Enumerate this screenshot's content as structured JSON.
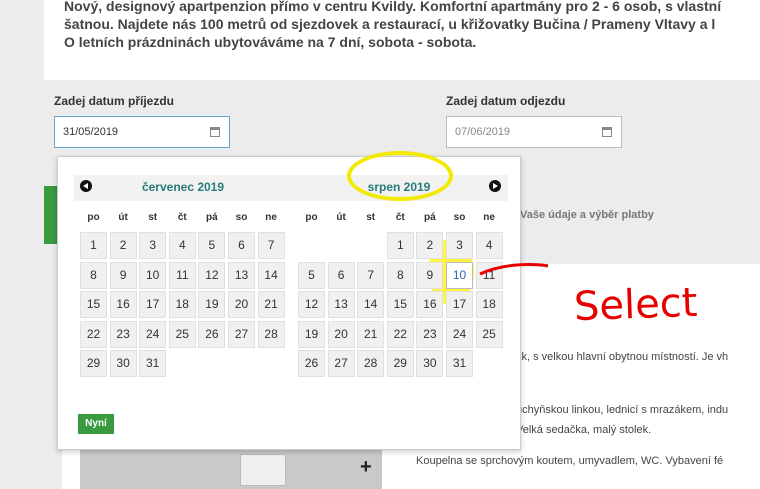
{
  "intro": {
    "line1": "Nový, designový apartpenzion přímo v centru Kvildy. Komfortní apartmány pro 2 - 6 osob, s vlastní",
    "line2": "šatnou. Najdete nás 100 metrů od sjezdovek a restaurací, u křižovatky Bučina / Prameny Vltavy a l",
    "line3": "O letních prázdninách ubytováváme na 7 dní, sobota - sobota."
  },
  "arrival": {
    "label": "Zadej datum příjezdu",
    "value": "31/05/2019"
  },
  "departure": {
    "label": "Zadej datum odjezdu",
    "value": "07/06/2019"
  },
  "datepicker": {
    "left_month": "červenec 2019",
    "right_month": "srpen 2019",
    "weekdays": [
      "po",
      "út",
      "st",
      "čt",
      "pá",
      "so",
      "ne"
    ],
    "left_start_col": 0,
    "left_days": 31,
    "right_start_col": 3,
    "right_days": 31,
    "selected_right_day": 10,
    "now_label": "Nyní"
  },
  "payment_step": "Vaše údaje a výběr platby",
  "content": {
    "line1": "kk, s velkou hlavní obytnou místností. Je vh",
    "line2": "uchyňskou linkou, lednicí s mrazákem, indu",
    "line3": "Velká sedačka, malý stolek.",
    "line4": "Koupelna se sprchovým koutem, umyvadlem, WC. Vybavení fé"
  },
  "annotation": {
    "word": "Select"
  },
  "colors": {
    "green": "#3a9a40",
    "teal": "#2a7a7a",
    "highlight": "#f2ea00",
    "red": "#e60000"
  }
}
